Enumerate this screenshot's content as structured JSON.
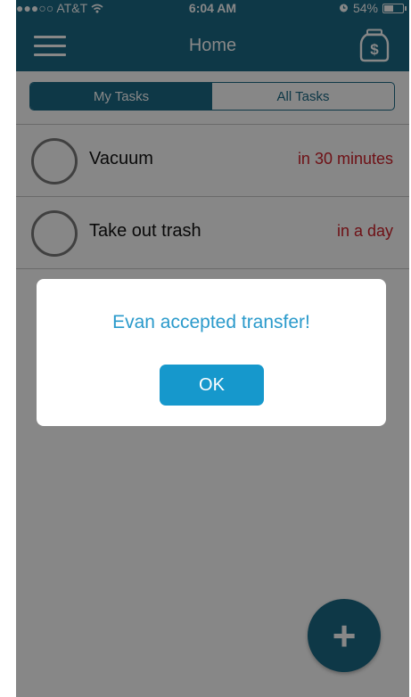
{
  "status_bar": {
    "carrier": "●●●○○ AT&T",
    "time": "6:04 AM",
    "battery_percent": "54%",
    "battery_level": 0.54,
    "icons": [
      "wifi-icon",
      "alarm-icon",
      "battery-icon"
    ]
  },
  "nav": {
    "title": "Home",
    "left_icon": "hamburger-menu-icon",
    "right_icon": "money-jar-icon"
  },
  "segments": {
    "my_tasks": "My Tasks",
    "all_tasks": "All Tasks",
    "selected": "My Tasks"
  },
  "tasks": [
    {
      "name": "Vacuum",
      "due": "in 30 minutes"
    },
    {
      "name": "Take out trash",
      "due": "in a day"
    }
  ],
  "dialog": {
    "message": "Evan accepted transfer!",
    "ok_label": "OK"
  },
  "fab": {
    "icon": "plus-icon",
    "label": "+"
  },
  "colors": {
    "primary": "#1b6a87",
    "button": "#1698cc",
    "due_text": "#d0202a",
    "dialog_text": "#2a9acb"
  }
}
